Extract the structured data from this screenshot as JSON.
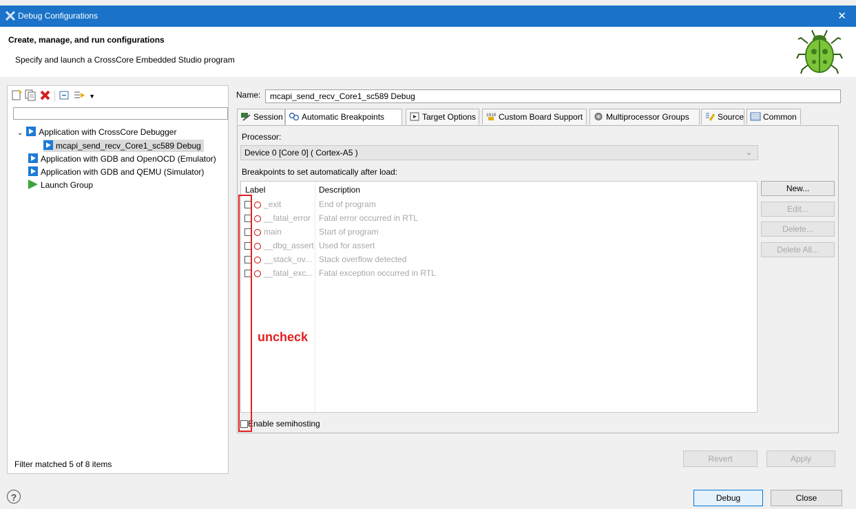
{
  "window": {
    "title": "Debug Configurations",
    "close_glyph": "✕"
  },
  "header": {
    "title": "Create, manage, and run configurations",
    "subtitle": "Specify and launch a CrossCore Embedded Studio program"
  },
  "left": {
    "filter_placeholder": "",
    "tree": [
      {
        "label": "Application with CrossCore Debugger",
        "level": 0,
        "expanded": true,
        "icon": "launch-icon"
      },
      {
        "label": "mcapi_send_recv_Core1_sc589 Debug",
        "level": 1,
        "selected": true,
        "icon": "launch-icon"
      },
      {
        "label": "Application with GDB and OpenOCD (Emulator)",
        "level": 0,
        "icon": "launch-icon"
      },
      {
        "label": "Application with GDB and QEMU (Simulator)",
        "level": 0,
        "icon": "launch-icon"
      },
      {
        "label": "Launch Group",
        "level": 0,
        "icon": "launch-group-icon"
      }
    ],
    "status": "Filter matched 5 of 8 items"
  },
  "right": {
    "name_label": "Name:",
    "name_value": "mcapi_send_recv_Core1_sc589 Debug",
    "tabs": [
      {
        "label": "Session"
      },
      {
        "label": "Automatic Breakpoints",
        "active": true
      },
      {
        "label": "Target Options"
      },
      {
        "label": "Custom Board Support"
      },
      {
        "label": "Multiprocessor Groups"
      },
      {
        "label": "Source"
      },
      {
        "label": "Common"
      }
    ],
    "processor_label": "Processor:",
    "processor_value": "Device 0 [Core 0] ( Cortex-A5 )",
    "breakpoints_label": "Breakpoints to set automatically after load:",
    "table": {
      "col_label": "Label",
      "col_desc": "Description",
      "rows": [
        {
          "label": "_exit",
          "desc": "End of program"
        },
        {
          "label": "__fatal_error",
          "desc": "Fatal error occurred in RTL"
        },
        {
          "label": "main",
          "desc": "Start of program"
        },
        {
          "label": "__dbg_assert",
          "desc": "Used for assert"
        },
        {
          "label": "__stack_ov...",
          "desc": "Stack overflow detected"
        },
        {
          "label": "__fatal_exc...",
          "desc": "Fatal exception occurred in RTL"
        }
      ]
    },
    "side_buttons": {
      "new": "New...",
      "edit": "Edit...",
      "delete": "Delete...",
      "delete_all": "Delete All..."
    },
    "semihosting_label": "Enable semihosting",
    "annotation": "uncheck",
    "revert": "Revert",
    "apply": "Apply"
  },
  "footer": {
    "help": "?",
    "debug": "Debug",
    "close": "Close"
  }
}
